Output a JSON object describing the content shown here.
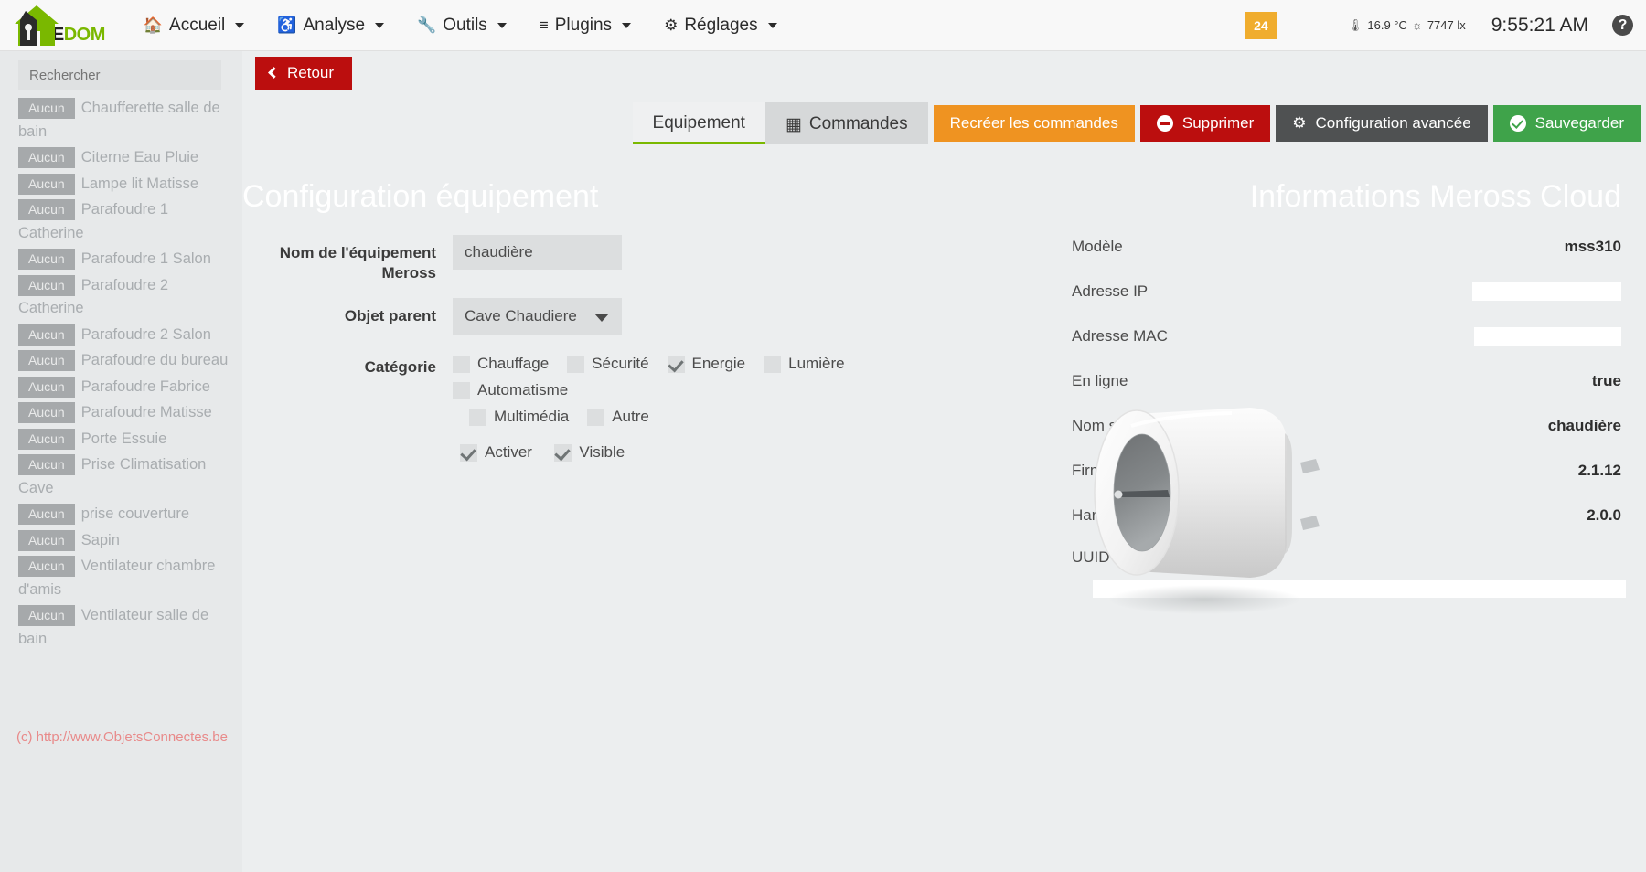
{
  "navbar": {
    "brand_part1": "EE",
    "brand_part2": "DOM",
    "items": [
      {
        "label": "Accueil",
        "icon": "home-icon"
      },
      {
        "label": "Analyse",
        "icon": "stethoscope-icon"
      },
      {
        "label": "Outils",
        "icon": "wrench-icon"
      },
      {
        "label": "Plugins",
        "icon": "list-icon"
      },
      {
        "label": "Réglages",
        "icon": "gear-icon"
      }
    ],
    "badge_count": "24",
    "temperature": "16.9 °C",
    "luminosity": "7747 lx",
    "clock": "9:55:21 AM",
    "help_glyph": "?"
  },
  "sidebar": {
    "search_placeholder": "Rechercher",
    "items": [
      {
        "badge": "Aucun",
        "label": "Chaufferette salle de bain"
      },
      {
        "badge": "Aucun",
        "label": "Citerne Eau Pluie"
      },
      {
        "badge": "Aucun",
        "label": "Lampe lit Matisse"
      },
      {
        "badge": "Aucun",
        "label": "Parafoudre 1 Catherine"
      },
      {
        "badge": "Aucun",
        "label": "Parafoudre 1 Salon"
      },
      {
        "badge": "Aucun",
        "label": "Parafoudre 2 Catherine"
      },
      {
        "badge": "Aucun",
        "label": "Parafoudre 2 Salon"
      },
      {
        "badge": "Aucun",
        "label": "Parafoudre du bureau"
      },
      {
        "badge": "Aucun",
        "label": "Parafoudre Fabrice"
      },
      {
        "badge": "Aucun",
        "label": "Parafoudre Matisse"
      },
      {
        "badge": "Aucun",
        "label": "Porte Essuie"
      },
      {
        "badge": "Aucun",
        "label": "Prise Climatisation Cave"
      },
      {
        "badge": "Aucun",
        "label": "prise couverture"
      },
      {
        "badge": "Aucun",
        "label": "Sapin"
      },
      {
        "badge": "Aucun",
        "label": "Ventilateur chambre d'amis"
      },
      {
        "badge": "Aucun",
        "label": "Ventilateur salle de bain"
      }
    ]
  },
  "toolbar": {
    "back_label": "Retour",
    "tab_equipement": "Equipement",
    "tab_commandes": "Commandes",
    "recreer_label": "Recréer les commandes",
    "supprimer_label": "Supprimer",
    "config_avancee_label": "Configuration avancée",
    "sauvegarder_label": "Sauvegarder"
  },
  "equipment_panel": {
    "title": "Configuration équipement",
    "name_label": "Nom de l'équipement Meross",
    "name_value": "chaudière",
    "parent_label": "Objet parent",
    "parent_value": "Cave Chaudiere",
    "category_label": "Catégorie",
    "categories": [
      {
        "label": "Chauffage",
        "checked": false
      },
      {
        "label": "Sécurité",
        "checked": false
      },
      {
        "label": "Energie",
        "checked": true
      },
      {
        "label": "Lumière",
        "checked": false
      },
      {
        "label": "Automatisme",
        "checked": false
      },
      {
        "label": "Multimédia",
        "checked": false
      },
      {
        "label": "Autre",
        "checked": false
      }
    ],
    "activer_label": "Activer",
    "activer_checked": true,
    "visible_label": "Visible",
    "visible_checked": true
  },
  "info_panel": {
    "title": "Informations Meross Cloud",
    "rows": [
      {
        "label": "Modèle",
        "value": "mss310",
        "redacted": false
      },
      {
        "label": "Adresse IP",
        "value": "",
        "redacted": true,
        "redact_width": 163
      },
      {
        "label": "Adresse MAC",
        "value": "",
        "redacted": true,
        "redact_width": 161
      },
      {
        "label": "En ligne",
        "value": "true",
        "redacted": false
      },
      {
        "label": "Nom sur l'app Meross",
        "value": "chaudière",
        "redacted": false
      },
      {
        "label": "Firmware version",
        "value": "2.1.12",
        "redacted": false
      },
      {
        "label": "Hardware version",
        "value": "2.0.0",
        "redacted": false
      }
    ],
    "uuid_label": "UUID",
    "uuid_value": "",
    "device_image_name": "meross-smart-plug-photo"
  },
  "watermark": "(c) http://www.ObjetsConnectes.be",
  "colors": {
    "accent_green": "#7ab800",
    "danger_red": "#bb0e0e",
    "warn_orange": "#ef9321",
    "dark_gray": "#4f5152",
    "success_green": "#3fa34a",
    "badge_orange": "#f0ad2e"
  }
}
